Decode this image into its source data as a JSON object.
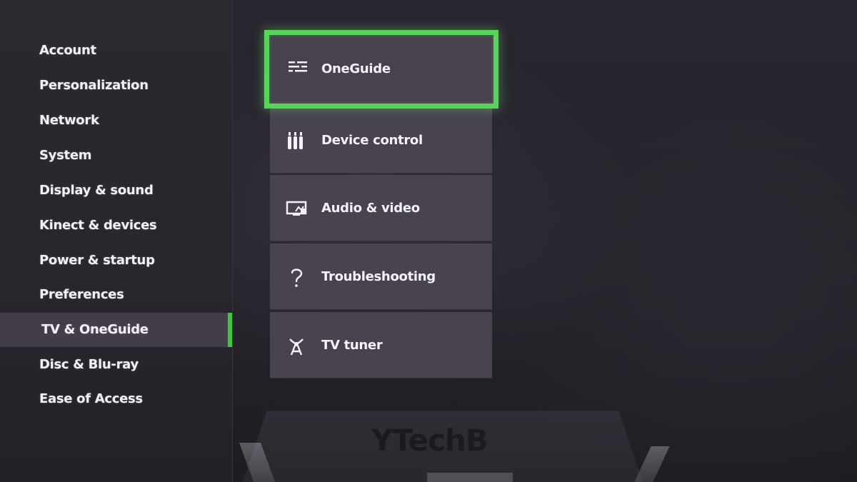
{
  "sidebar": {
    "items": [
      {
        "label": "Account"
      },
      {
        "label": "Personalization"
      },
      {
        "label": "Network"
      },
      {
        "label": "System"
      },
      {
        "label": "Display & sound"
      },
      {
        "label": "Kinect & devices"
      },
      {
        "label": "Power & startup"
      },
      {
        "label": "Preferences"
      },
      {
        "label": "TV & OneGuide",
        "selected": true
      },
      {
        "label": "Disc & Blu-ray"
      },
      {
        "label": "Ease of Access"
      }
    ]
  },
  "submenu": {
    "items": [
      {
        "label": "OneGuide",
        "icon": "list-lines-icon",
        "focused": true
      },
      {
        "label": "Device control",
        "icon": "remote-control-icon"
      },
      {
        "label": "Audio & video",
        "icon": "monitor-icon"
      },
      {
        "label": "Troubleshooting",
        "icon": "question-mark-icon"
      },
      {
        "label": "TV tuner",
        "icon": "antenna-tower-icon"
      }
    ]
  },
  "watermark": {
    "text": "YTechB"
  },
  "colors": {
    "accent": "#58d45a",
    "selected_bar": "#3cc83c",
    "tile": "#48434f",
    "sidebar": "#2b2830"
  }
}
